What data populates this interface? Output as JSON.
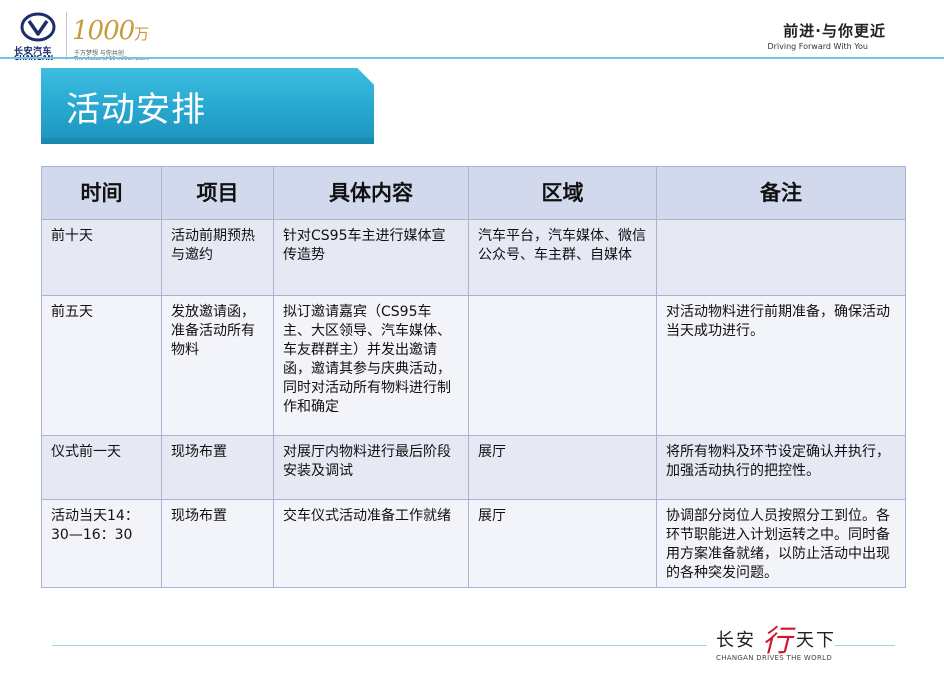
{
  "header": {
    "logo_cn": "长安汽车",
    "logo_en": "CHANGAN",
    "badge_number": "1000",
    "badge_unit": "万",
    "badge_cn": "千万梦想 与你共创",
    "badge_en": "The choice of 10 million users",
    "slogan_cn": "前进·与你更近",
    "slogan_en": "Driving Forward With You"
  },
  "title": "活动安排",
  "table": {
    "headers": [
      "时间",
      "项目",
      "具体内容",
      "区域",
      "备注"
    ],
    "rows": [
      [
        "前十天",
        "活动前期预热与邀约",
        "针对CS95车主进行媒体宣传造势",
        "汽车平台，汽车媒体、微信公众号、车主群、自媒体",
        ""
      ],
      [
        "前五天",
        "发放邀请函，准备活动所有物料",
        "拟订邀请嘉宾（CS95车主、大区领导、汽车媒体、车友群群主）并发出邀请函，邀请其参与庆典活动，同时对活动所有物料进行制作和确定",
        "",
        "对活动物料进行前期准备，确保活动当天成功进行。"
      ],
      [
        "仪式前一天",
        "现场布置",
        "对展厅内物料进行最后阶段安装及调试",
        "展厅",
        "将所有物料及环节设定确认并执行，加强活动执行的把控性。"
      ],
      [
        "活动当天14：30—16：30",
        "现场布置",
        "交车仪式活动准备工作就绪",
        "展厅",
        "协调部分岗位人员按照分工到位。各环节职能进入计划运转之中。同时备用方案准备就绪，以防止活动中出现的各种突发问题。"
      ]
    ]
  },
  "footer": {
    "brand_cn_left": "长安",
    "brand_mark": "行",
    "brand_cn_right": "天下",
    "brand_en": "CHANGAN DRIVES   THE WORLD"
  },
  "colors": {
    "accent": "#27a7cf",
    "table_border": "#a9b3d6",
    "header_fill": "#d3d9ec",
    "row_fill_dark": "#e6e9f4",
    "row_fill_light": "#f3f4fa",
    "brand_red": "#d2162a",
    "badge_gold": "#c79a3e"
  },
  "icons": {
    "logo": "changan-v-emblem-icon",
    "footer_mark": "calligraphy-xing-icon"
  }
}
